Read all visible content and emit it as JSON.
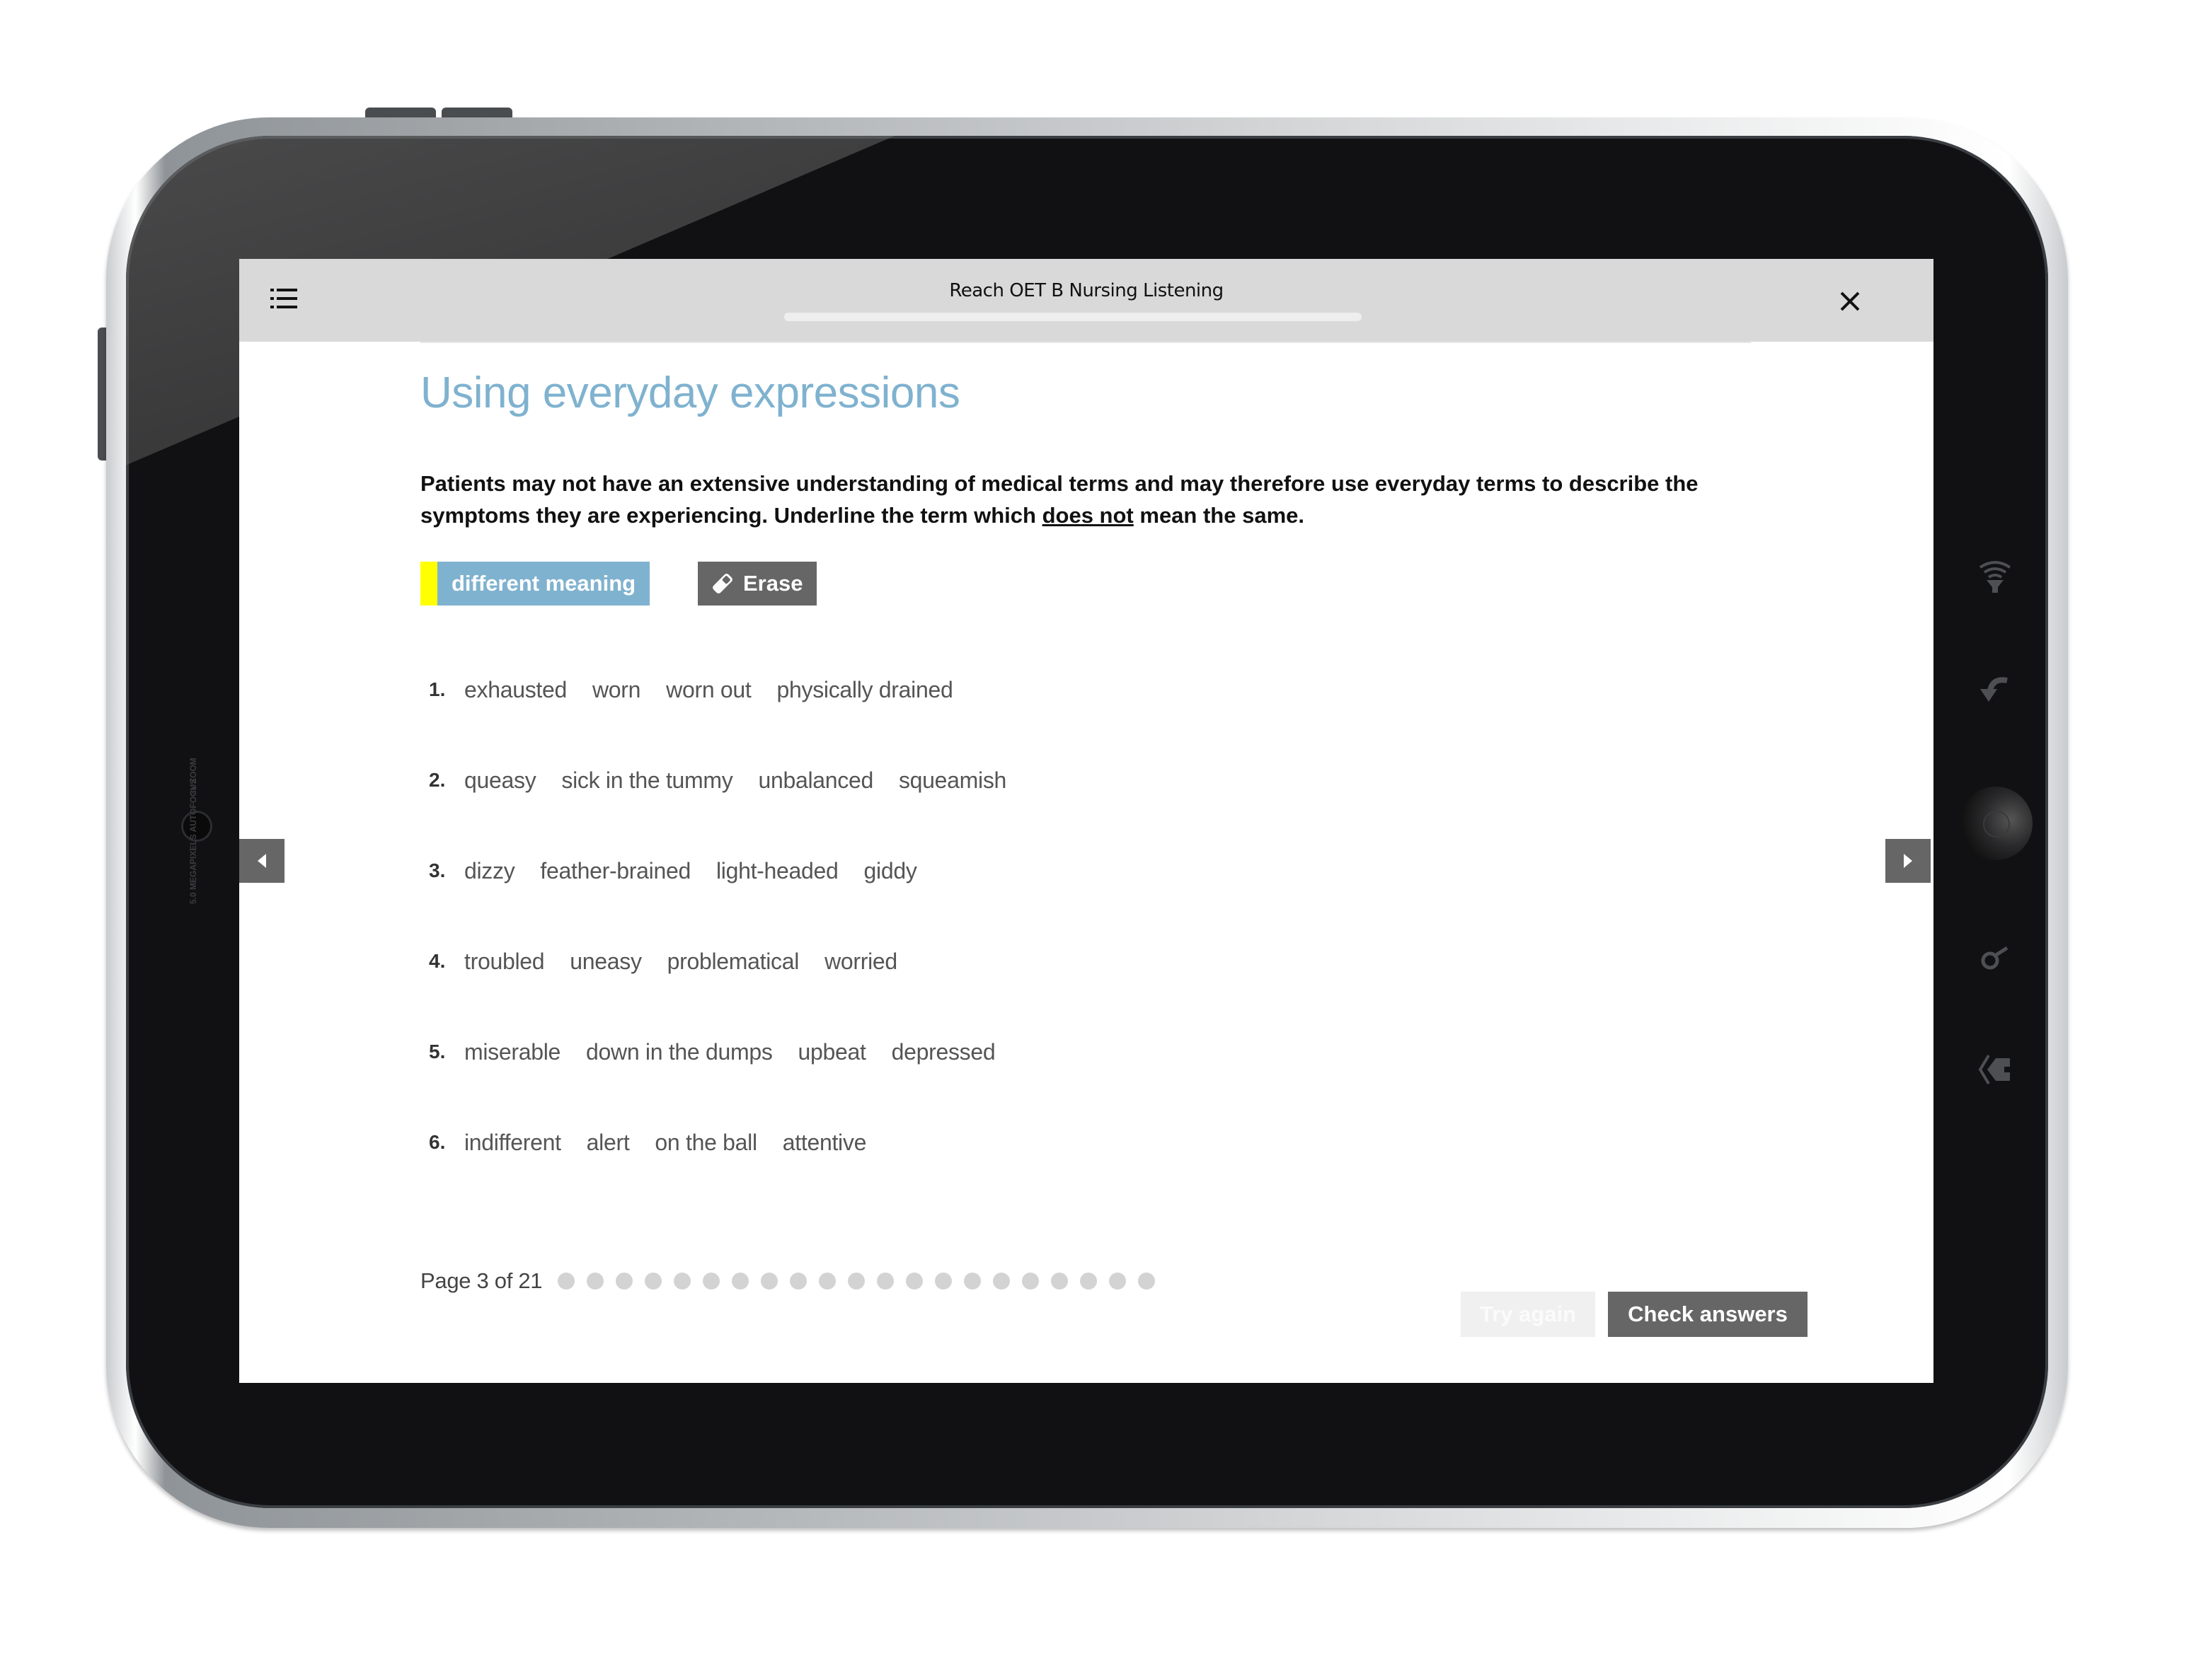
{
  "device": {
    "camera_label_zoom": "3x ZOOM",
    "camera_label_mp": "5.0 MEGAPIXELS AUTOFOCUS"
  },
  "header": {
    "title": "Reach OET B Nursing Listening",
    "menu_icon": "list-icon",
    "close_icon": "close-icon",
    "progress_fraction": 0
  },
  "exercise": {
    "title": "Using everyday expressions",
    "instruction_before": "Patients may not have an extensive understanding of medical terms and may therefore use everyday terms to describe the symptoms they are experiencing. Underline the term which ",
    "instruction_underlined": "does not",
    "instruction_after": " mean the same."
  },
  "tools": {
    "highlight_label": "different meaning",
    "highlight_color": "#ffff00",
    "highlight_bg": "#7fb2cf",
    "erase_label": "Erase",
    "erase_icon": "eraser-icon"
  },
  "questions": [
    {
      "number": "1.",
      "options": [
        "exhausted",
        "worn",
        "worn out",
        "physically drained"
      ]
    },
    {
      "number": "2.",
      "options": [
        "queasy",
        "sick in the tummy",
        "unbalanced",
        "squeamish"
      ]
    },
    {
      "number": "3.",
      "options": [
        "dizzy",
        "feather-brained",
        "light-headed",
        "giddy"
      ]
    },
    {
      "number": "4.",
      "options": [
        "troubled",
        "uneasy",
        "problematical",
        "worried"
      ]
    },
    {
      "number": "5.",
      "options": [
        "miserable",
        "down in the dumps",
        "upbeat",
        "depressed"
      ]
    },
    {
      "number": "6.",
      "options": [
        "indifferent",
        "alert",
        "on the ball",
        "attentive"
      ]
    }
  ],
  "pager": {
    "label": "Page 3 of 21",
    "current_page": 3,
    "total_pages": 21
  },
  "actions": {
    "try_again_label": "Try again",
    "check_answers_label": "Check answers"
  },
  "navigation": {
    "prev_icon": "caret-left-icon",
    "next_icon": "caret-right-icon"
  },
  "colors": {
    "accent": "#7fb2cf",
    "button_dark": "#666666",
    "header_bg": "#d9d9d9",
    "dot": "#d3d3d3"
  }
}
